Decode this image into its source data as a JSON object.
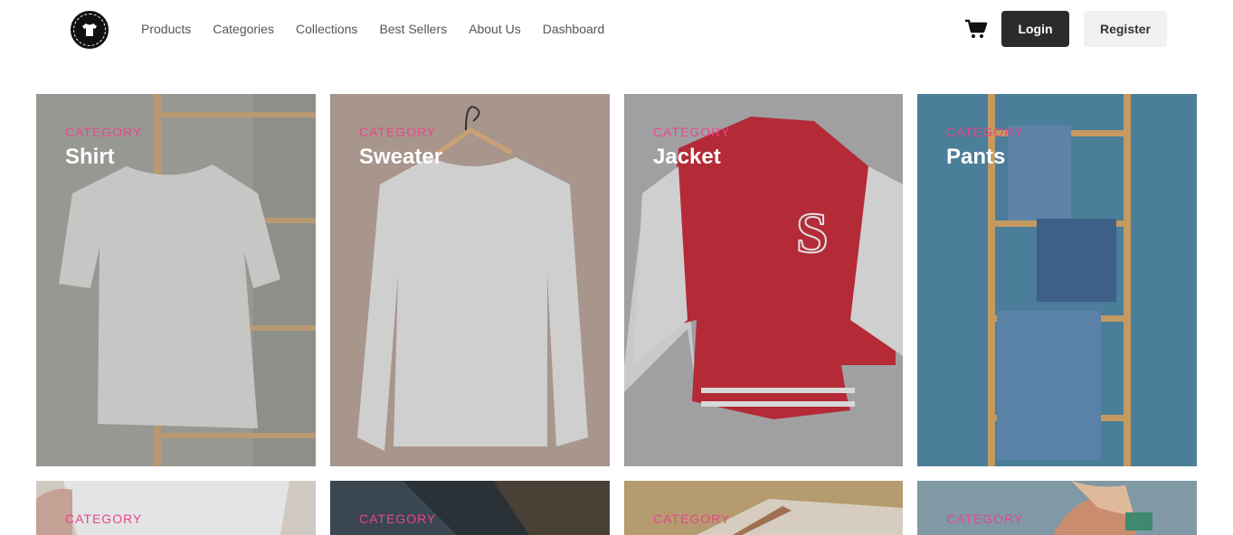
{
  "header": {
    "nav": [
      "Products",
      "Categories",
      "Collections",
      "Best Sellers",
      "About Us",
      "Dashboard"
    ],
    "login_label": "Login",
    "register_label": "Register",
    "logo_icon": "tshirt-logo-icon",
    "cart_icon": "cart-icon"
  },
  "categories": [
    {
      "label": "CATEGORY",
      "name": "Shirt"
    },
    {
      "label": "CATEGORY",
      "name": "Sweater"
    },
    {
      "label": "CATEGORY",
      "name": "Jacket"
    },
    {
      "label": "CATEGORY",
      "name": "Pants"
    },
    {
      "label": "CATEGORY",
      "name": ""
    },
    {
      "label": "CATEGORY",
      "name": ""
    },
    {
      "label": "CATEGORY",
      "name": ""
    },
    {
      "label": "CATEGORY",
      "name": ""
    }
  ],
  "colors": {
    "accent": "#e8468c",
    "login_bg": "#2b2b2b",
    "register_bg": "#f1f1f1"
  }
}
